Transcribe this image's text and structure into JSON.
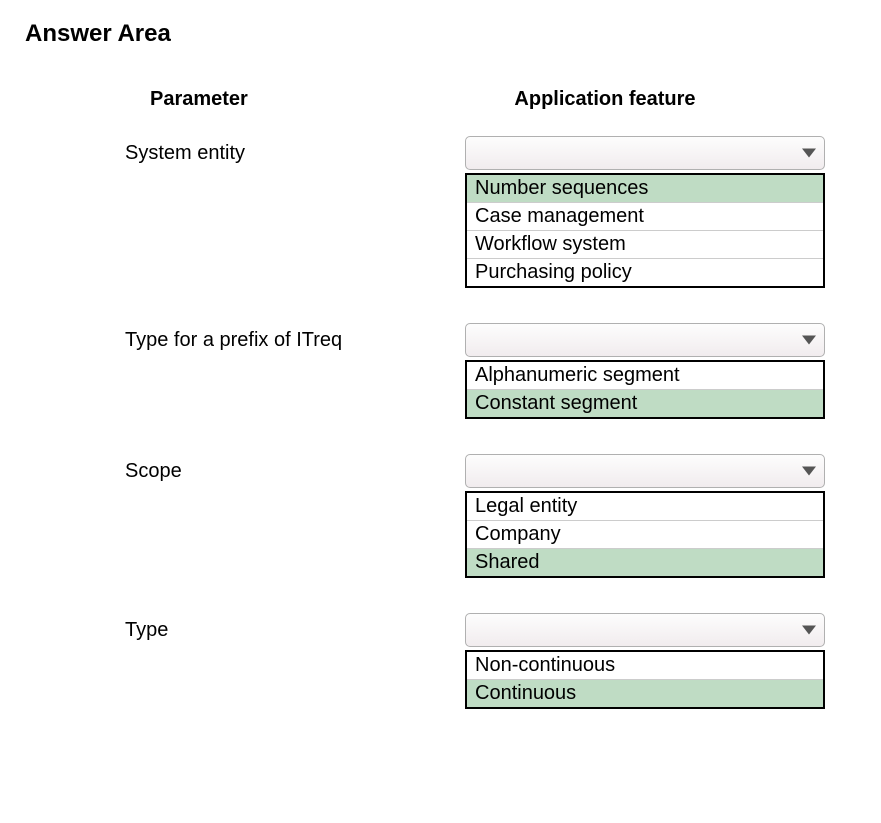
{
  "title": "Answer Area",
  "headers": {
    "parameter": "Parameter",
    "feature": "Application feature"
  },
  "rows": [
    {
      "param": "System entity",
      "options": [
        {
          "label": "Number sequences",
          "highlighted": true
        },
        {
          "label": "Case management",
          "highlighted": false
        },
        {
          "label": "Workflow system",
          "highlighted": false
        },
        {
          "label": "Purchasing policy",
          "highlighted": false
        }
      ]
    },
    {
      "param": "Type for a prefix of ITreq",
      "options": [
        {
          "label": "Alphanumeric segment",
          "highlighted": false
        },
        {
          "label": "Constant segment",
          "highlighted": true
        }
      ]
    },
    {
      "param": "Scope",
      "options": [
        {
          "label": "Legal entity",
          "highlighted": false
        },
        {
          "label": "Company",
          "highlighted": false
        },
        {
          "label": "Shared",
          "highlighted": true
        }
      ]
    },
    {
      "param": "Type",
      "options": [
        {
          "label": "Non-continuous",
          "highlighted": false
        },
        {
          "label": "Continuous",
          "highlighted": true
        }
      ]
    }
  ]
}
